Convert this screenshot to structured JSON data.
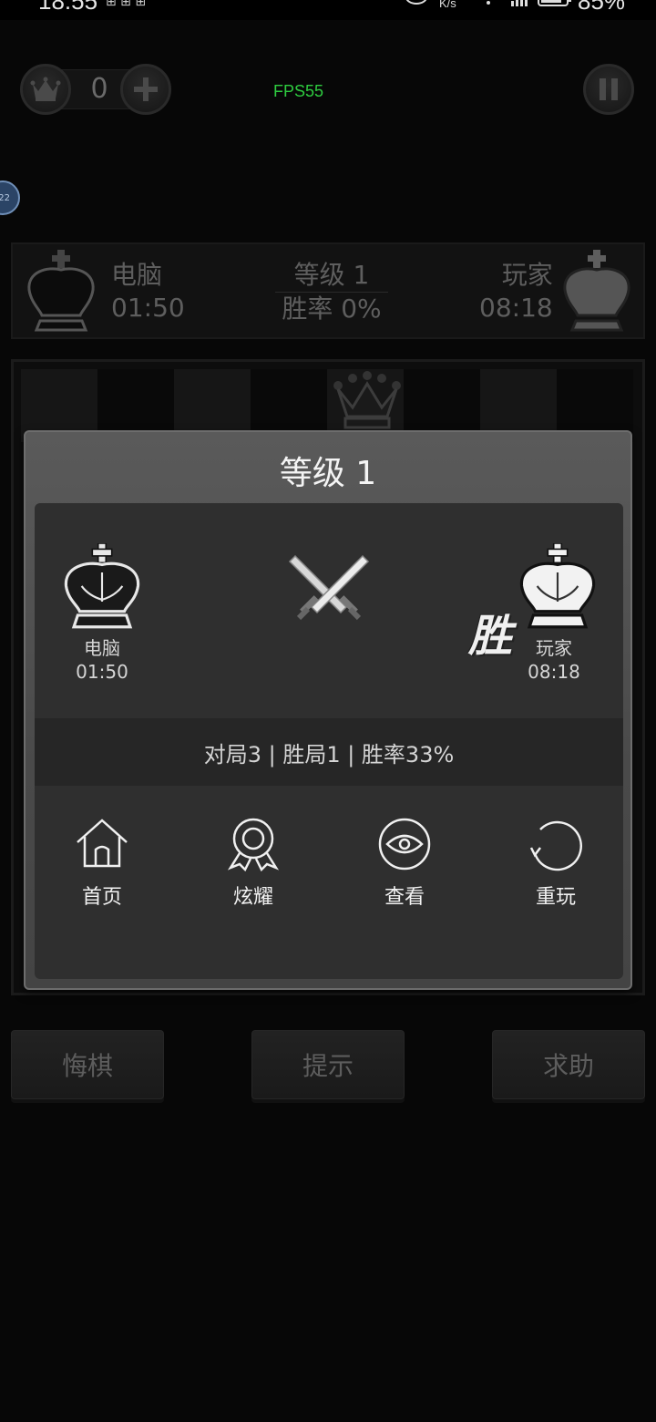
{
  "status_bar": {
    "time": "18:55",
    "notification_dots": "⊞ ⊞ ⊞",
    "net_speed_unit": "K/s",
    "battery_percent": "85%",
    "icons": [
      "eye-icon",
      "wifi-icon",
      "signal-icon",
      "battery-icon"
    ]
  },
  "top_bar": {
    "coin_count": "0",
    "fps": "FPS55",
    "icons": [
      "crown-coin-icon",
      "plus-icon",
      "pause-icon"
    ]
  },
  "side_badge": "22",
  "player_panel": {
    "left_name": "电脑",
    "left_time": "01:50",
    "level": "等级 1",
    "win_rate": "胜率 0%",
    "right_name": "玩家",
    "right_time": "08:18"
  },
  "bottom_buttons": {
    "undo": "悔棋",
    "hint": "提示",
    "help": "求助"
  },
  "dialog": {
    "title": "等级 1",
    "left_player": {
      "name": "电脑",
      "time": "01:50",
      "icon": "black-king-icon"
    },
    "right_player": {
      "name": "玩家",
      "time": "08:18",
      "icon": "white-king-icon"
    },
    "center_icon": "crossed-swords-icon",
    "win_mark": "胜",
    "stats": "对局3 | 胜局1 | 胜率33%",
    "actions": [
      {
        "label": "首页",
        "icon": "home-icon"
      },
      {
        "label": "炫耀",
        "icon": "medal-icon"
      },
      {
        "label": "查看",
        "icon": "eye-icon"
      },
      {
        "label": "重玩",
        "icon": "replay-icon"
      }
    ]
  },
  "colors": {
    "background": "#070707",
    "dialog": "#4e4e4e",
    "dialog_inner": "#2f2f2f",
    "fps_text": "#2ecc40"
  }
}
